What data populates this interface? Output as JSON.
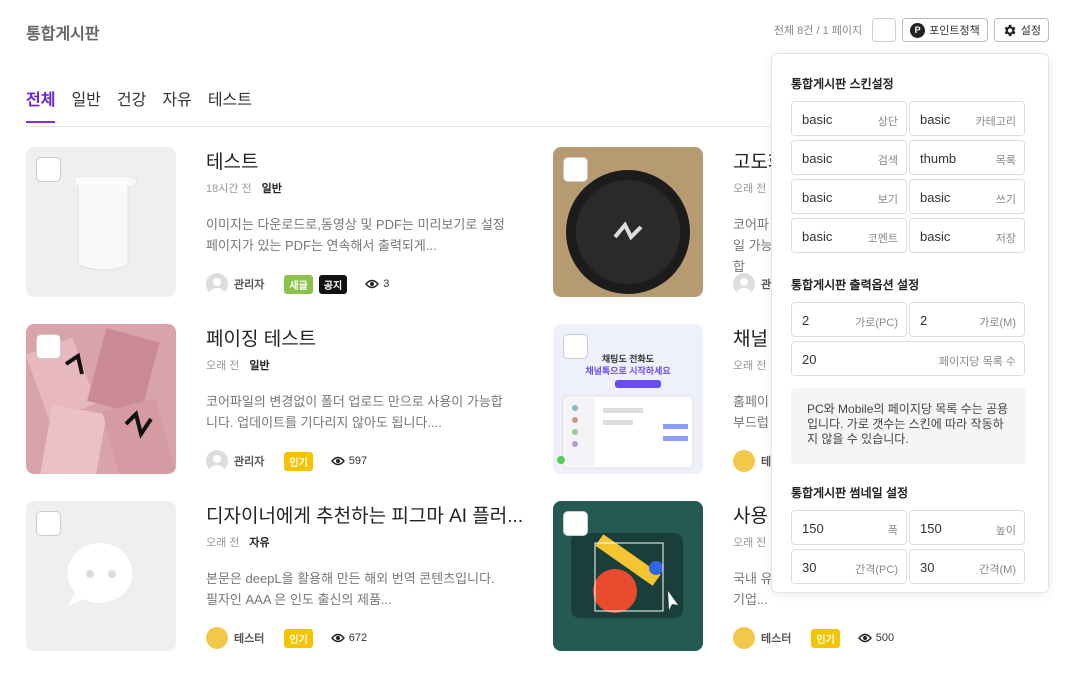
{
  "header": {
    "title": "통합게시판",
    "count_text": "전체 8건 / 1 페이지",
    "point_label": "포인트정책",
    "point_badge": "P",
    "settings_label": "설정"
  },
  "tabs": [
    "전체",
    "일반",
    "건강",
    "자유",
    "테스트"
  ],
  "posts": [
    {
      "title": "테스트",
      "time": "18시간 전",
      "category": "일반",
      "desc": "이미지는 다운로드로,동영상 및 PDF는 미리보기로 설정페이지가 있는 PDF는 연속해서 출력되게...",
      "author": "관리자",
      "badges": [
        "새글",
        "공지"
      ],
      "views": "3"
    },
    {
      "title": "고도화",
      "time": "오래 전",
      "category": "",
      "desc": "코어파일 가능합",
      "author": "관리",
      "badges": [],
      "views": ""
    },
    {
      "title": "페이징 테스트",
      "time": "오래 전",
      "category": "일반",
      "desc": "코어파일의 변경없이 폴더 업로드 만으로 사용이 가능합니다. 업데이트를 기다리지 않아도 됩니다....",
      "author": "관리자",
      "badges": [
        "인기"
      ],
      "views": "597"
    },
    {
      "title": "채널",
      "time": "오래 전",
      "category": "",
      "desc": "홈페이 부드럽",
      "author": "테",
      "badges": [],
      "views": ""
    },
    {
      "title": "디자이너에게 추천하는 피그마 AI 플러...",
      "time": "오래 전",
      "category": "자유",
      "desc": "본문은 deepL을 활용해 만든 해외 번역 콘텐츠입니다. 필자인 AAA 은 인도 출신의 제품...",
      "author": "테스터",
      "badges": [
        "인기"
      ],
      "views": "672"
    },
    {
      "title": "사용",
      "time": "오래 전",
      "category": "",
      "desc": "국내 유 뛰어난 기술과 아이디어를 사랑합니다. 이들은 기업...",
      "author": "테스터",
      "badges": [
        "인기"
      ],
      "views": "500"
    }
  ],
  "thumb2_text": {
    "line1": "채팅도 전화도",
    "line2": "채널톡으로 시작하세요"
  },
  "panel": {
    "skin_title": "통합게시판 스킨설정",
    "skin_fields": [
      {
        "value": "basic",
        "label": "상단"
      },
      {
        "value": "basic",
        "label": "카테고리"
      },
      {
        "value": "basic",
        "label": "검색"
      },
      {
        "value": "thumb",
        "label": "목록"
      },
      {
        "value": "basic",
        "label": "보기"
      },
      {
        "value": "basic",
        "label": "쓰기"
      },
      {
        "value": "basic",
        "label": "코멘트"
      },
      {
        "value": "basic",
        "label": "저장"
      }
    ],
    "output_title": "통합게시판 출력옵션 설정",
    "output_fields": [
      {
        "value": "2",
        "label": "가로(PC)"
      },
      {
        "value": "2",
        "label": "가로(M)"
      }
    ],
    "page_field": {
      "value": "20",
      "label": "페이지당 목록 수"
    },
    "note": "PC와 Mobile의 페이지당 목록 수는 공용입니다. 가로 갯수는 스킨에 따라 작동하지 않을 수 있습니다.",
    "thumb_title": "통합게시판 썸네일 설정",
    "thumb_fields": [
      {
        "value": "150",
        "label": "폭"
      },
      {
        "value": "150",
        "label": "높이"
      },
      {
        "value": "30",
        "label": "간격(PC)"
      },
      {
        "value": "30",
        "label": "간격(M)"
      }
    ]
  },
  "colors": {
    "accent": "#8a2be2",
    "hot": "#f5c400",
    "new": "#8bc34a"
  }
}
